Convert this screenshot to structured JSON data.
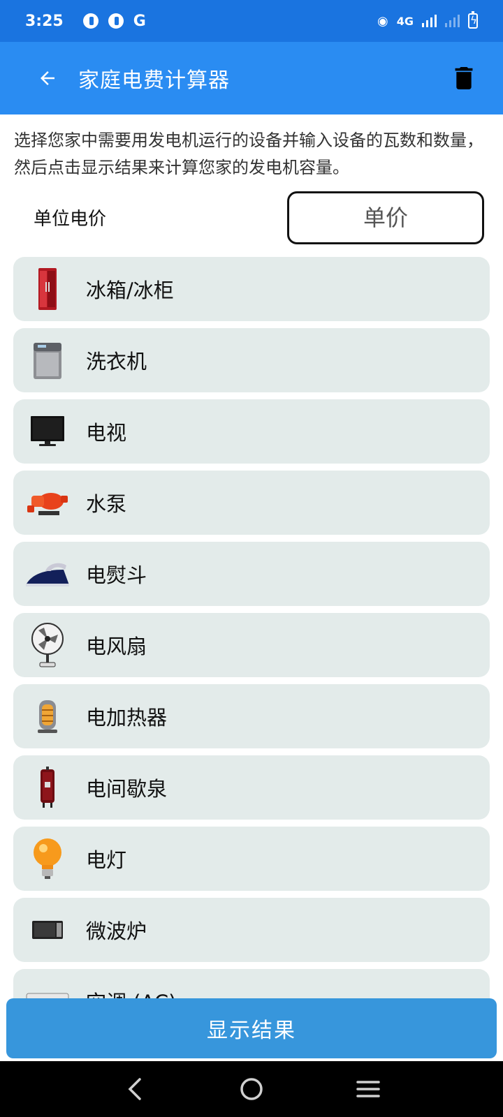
{
  "status_bar": {
    "time": "3:25",
    "g_label": "G",
    "network": "4G"
  },
  "app_bar": {
    "title": "家庭电费计算器",
    "back_icon": "arrow-left-icon",
    "delete_icon": "trash-icon"
  },
  "description": "选择您家中需要用发电机运行的设备并输入设备的瓦数和数量，然后点击显示结果来计算您家的发电机容量。",
  "price": {
    "label": "单位电价",
    "placeholder": "单价",
    "value": ""
  },
  "devices": [
    {
      "label": "冰箱/冰柜",
      "icon": "fridge-icon"
    },
    {
      "label": "洗衣机",
      "icon": "washing-machine-icon"
    },
    {
      "label": "电视",
      "icon": "tv-icon"
    },
    {
      "label": "水泵",
      "icon": "water-pump-icon"
    },
    {
      "label": "电熨斗",
      "icon": "iron-icon"
    },
    {
      "label": "电风扇",
      "icon": "fan-icon"
    },
    {
      "label": "电加热器",
      "icon": "heater-icon"
    },
    {
      "label": "电间歇泉",
      "icon": "water-heater-icon"
    },
    {
      "label": "电灯",
      "icon": "light-bulb-icon"
    },
    {
      "label": "微波炉",
      "icon": "microwave-icon"
    },
    {
      "label": "空调 (AC)",
      "icon": "air-conditioner-icon"
    }
  ],
  "show_results_label": "显示结果",
  "nav": {
    "back_icon": "nav-back-icon",
    "home_icon": "nav-home-icon",
    "menu_icon": "nav-menu-icon"
  },
  "colors": {
    "status_bar": "#1a74e0",
    "app_bar": "#2a8cf2",
    "item_bg": "#e3ebea",
    "button": "#3796dc"
  }
}
